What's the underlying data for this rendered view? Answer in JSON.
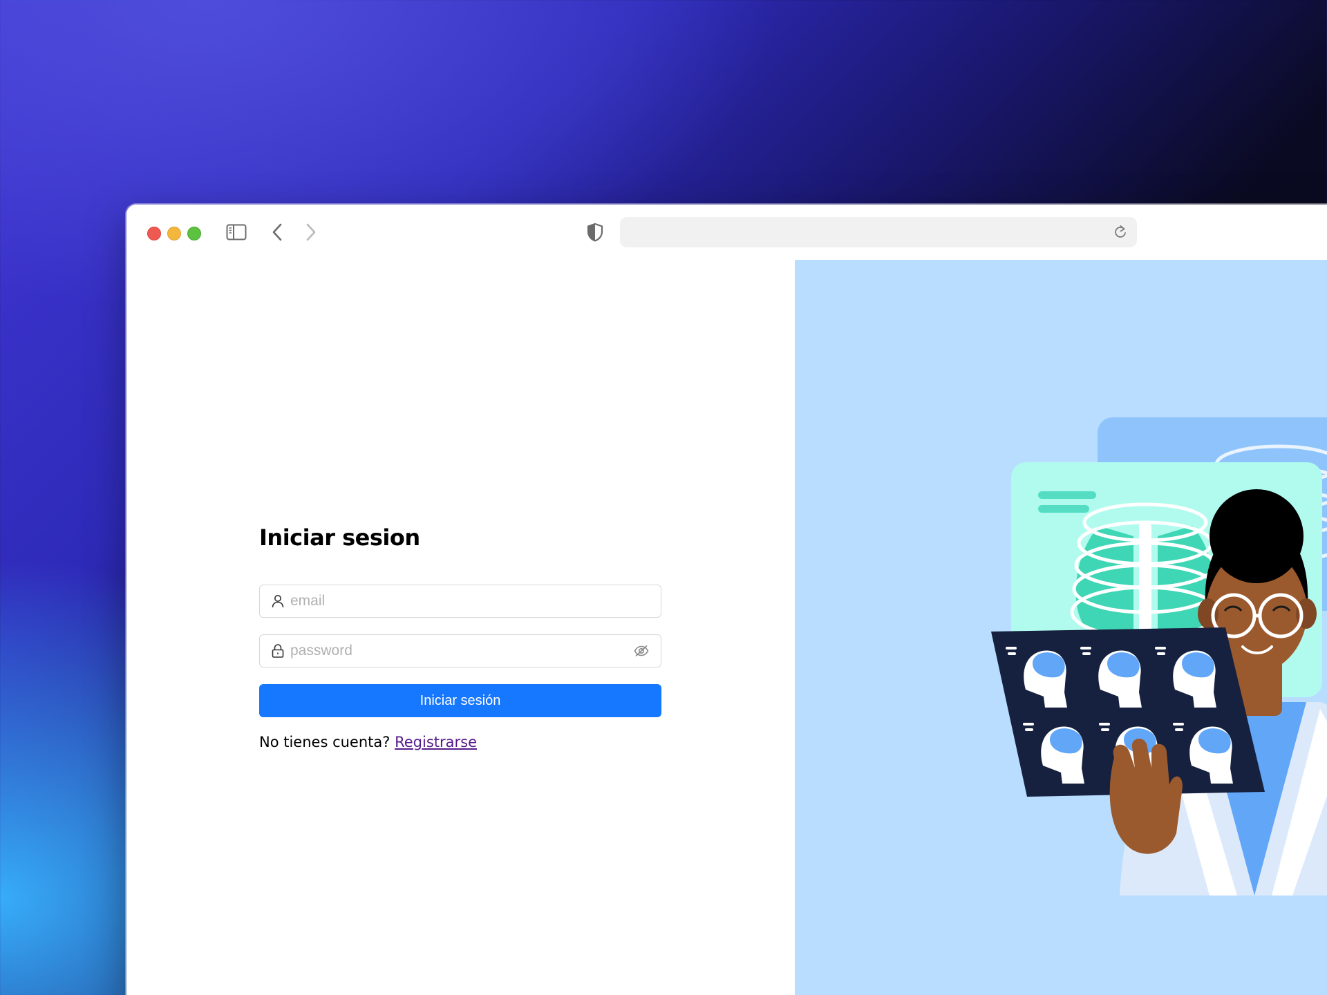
{
  "browser": {
    "address": "",
    "icons": {
      "sidebar": "sidebar-icon",
      "back": "chevron-left-icon",
      "forward": "chevron-right-icon",
      "privacy": "shield-icon",
      "reload": "reload-icon"
    },
    "traffic_lights": [
      "#ee5a52",
      "#f4b73e",
      "#5cc23f"
    ]
  },
  "login": {
    "title": "Iniciar sesion",
    "email_placeholder": "email",
    "email_value": "",
    "password_placeholder": "password",
    "password_value": "",
    "submit_label": "Iniciar sesión",
    "signup_prompt": "No tienes cuenta?",
    "signup_link": "Registrarse"
  },
  "colors": {
    "primary": "#1677ff",
    "illustration_bg": "#b9ddff",
    "link": "#551a8b"
  }
}
